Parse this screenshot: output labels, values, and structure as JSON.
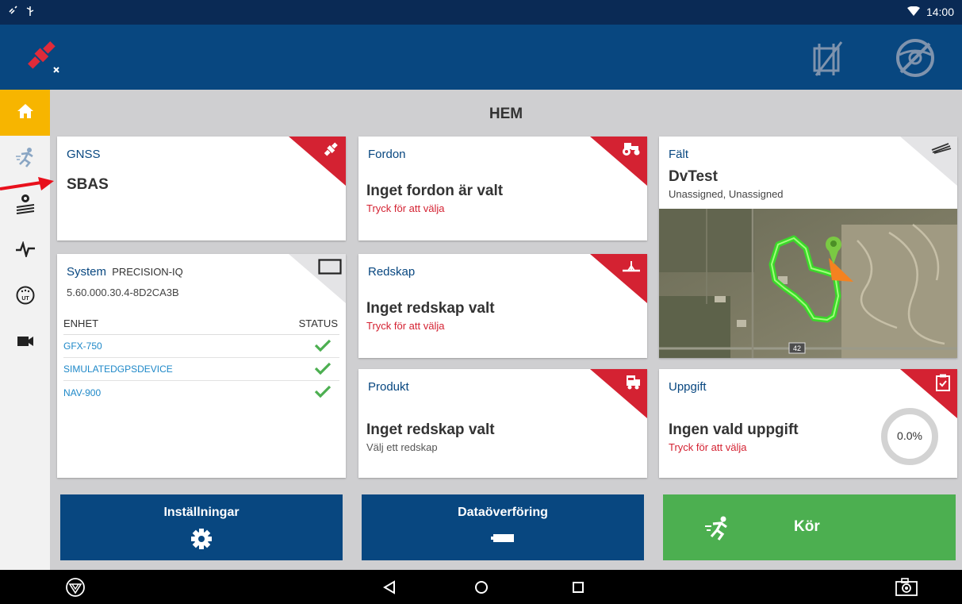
{
  "statusbar": {
    "time": "14:00"
  },
  "page_title": "HEM",
  "gnss": {
    "title": "GNSS",
    "value": "SBAS"
  },
  "system": {
    "title": "System",
    "product": "PRECISION-IQ",
    "version": "5.60.000.30.4-8D2CA3B",
    "col_device": "ENHET",
    "col_status": "STATUS",
    "devices": [
      {
        "name": "GFX-750"
      },
      {
        "name": "SIMULATEDGPSDEVICE"
      },
      {
        "name": "NAV-900"
      }
    ]
  },
  "vehicle": {
    "title": "Fordon",
    "main": "Inget fordon är valt",
    "hint": "Tryck för att välja"
  },
  "implement": {
    "title": "Redskap",
    "main": "Inget redskap valt",
    "hint": "Tryck för att välja"
  },
  "product": {
    "title": "Produkt",
    "main": "Inget redskap valt",
    "hint": "Välj ett redskap"
  },
  "field": {
    "title": "Fält",
    "name": "DvTest",
    "client": "Unassigned, Unassigned",
    "road_label": "42"
  },
  "task": {
    "title": "Uppgift",
    "main": "Ingen vald uppgift",
    "hint": "Tryck för att välja",
    "progress": "0.0%"
  },
  "buttons": {
    "settings": "Inställningar",
    "transfer": "Dataöverföring",
    "run": "Kör"
  },
  "colors": {
    "appbar": "#084780",
    "accent_red": "#d42232",
    "active_nav": "#f7b500",
    "run_green": "#4caf50",
    "link_blue": "#1e88c8"
  }
}
